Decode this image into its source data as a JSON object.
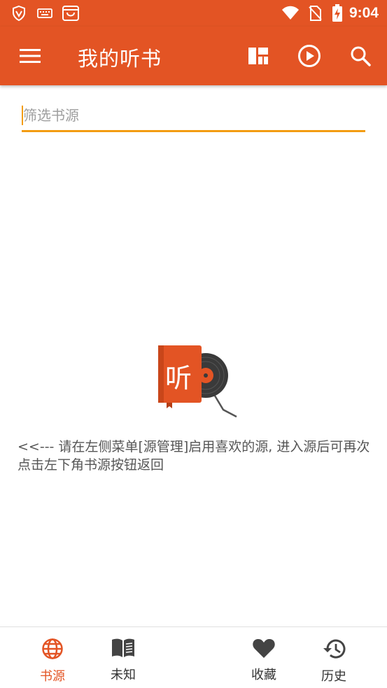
{
  "status_bar": {
    "time": "9:04",
    "icons": [
      "shield-icon",
      "keyboard-icon",
      "shopping-bag-icon",
      "wifi-icon",
      "no-sim-icon",
      "battery-charging-icon"
    ]
  },
  "toolbar": {
    "title": "我的听书",
    "icons": [
      "menu-icon",
      "layout-icon",
      "play-circle-icon",
      "search-icon"
    ]
  },
  "filter": {
    "placeholder": "筛选书源",
    "value": ""
  },
  "empty_state": {
    "logo_text": "听",
    "message": "<<--- 请在左侧菜单[源管理]启用喜欢的源, 进入源后可再次点击左下角书源按钮返回"
  },
  "bottom_nav": {
    "items": [
      {
        "label": "书源",
        "icon": "globe-icon",
        "active": true
      },
      {
        "label": "未知",
        "icon": "book-open-icon",
        "active": false
      },
      {
        "label": "收藏",
        "icon": "heart-icon",
        "active": false
      },
      {
        "label": "历史",
        "icon": "history-icon",
        "active": false
      }
    ]
  },
  "colors": {
    "primary": "#E35424",
    "accent": "#F39C12"
  }
}
